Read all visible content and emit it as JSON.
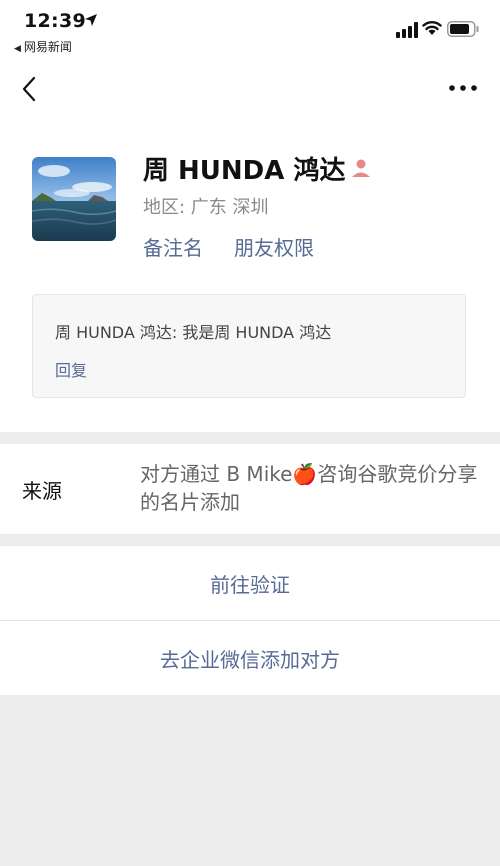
{
  "status_bar": {
    "time": "12:39",
    "back_app": "网易新闻",
    "icons": [
      "location-arrow-icon",
      "signal-icon",
      "wifi-icon",
      "battery-icon"
    ]
  },
  "nav": {
    "icons": [
      "chevron-left-icon",
      "more-icon"
    ]
  },
  "profile": {
    "name": "周 HUNDA 鸿达",
    "region": "地区: 广东 深圳",
    "remark_link": "备注名",
    "permission_link": "朋友权限"
  },
  "message": {
    "text": "周 HUNDA 鸿达: 我是周 HUNDA 鸿达",
    "reply": "回复"
  },
  "source": {
    "label": "来源",
    "value": "对方通过 B Mike🍎咨询谷歌竞价分享的名片添加"
  },
  "actions": {
    "verify": "前往验证",
    "enterprise_add": "去企业微信添加对方"
  },
  "colors": {
    "link": "#576b95",
    "background": "#ededed",
    "card": "#f7f7f7"
  }
}
